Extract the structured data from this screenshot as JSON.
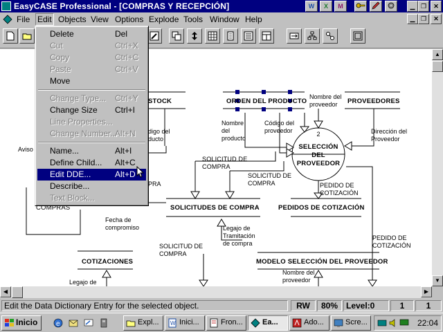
{
  "window": {
    "title": "EasyCASE Professional - [COMPRAS Y RECEPCIÓN]",
    "quick_buttons": [
      "W",
      "X",
      "M",
      "",
      "",
      "",
      ""
    ]
  },
  "menubar": {
    "items": [
      "File",
      "Edit",
      "Objects",
      "View",
      "Options",
      "Explode",
      "Tools",
      "Window",
      "Help"
    ]
  },
  "edit_menu": {
    "items": [
      {
        "label": "Delete",
        "accel": "Del",
        "enabled": true
      },
      {
        "label": "Cut",
        "accel": "Ctrl+X",
        "enabled": false
      },
      {
        "label": "Copy",
        "accel": "Ctrl+C",
        "enabled": false
      },
      {
        "label": "Paste",
        "accel": "Ctrl+V",
        "enabled": false
      },
      {
        "label": "Move",
        "accel": "",
        "enabled": true
      },
      {
        "label": "Change Type...",
        "accel": "Ctrl+Y",
        "enabled": false
      },
      {
        "label": "Change Size",
        "accel": "Ctrl+I",
        "enabled": true
      },
      {
        "label": "Line Properties...",
        "accel": "",
        "enabled": false
      },
      {
        "label": "Change Number...",
        "accel": "Alt+N",
        "enabled": false
      },
      {
        "label": "Name...",
        "accel": "Alt+I",
        "enabled": true
      },
      {
        "label": "Define Child...",
        "accel": "Alt+C",
        "enabled": true
      },
      {
        "label": "Edit DDE...",
        "accel": "Alt+D",
        "enabled": true,
        "selected": true
      },
      {
        "label": "Describe...",
        "accel": "",
        "enabled": true
      },
      {
        "label": "Text Block...",
        "accel": "",
        "enabled": false
      }
    ]
  },
  "diagram": {
    "stores": [
      "STOCK",
      "ORDEN DEL PRODUCTO",
      "PROVEEDORES",
      "SOLICITUDES DE COMPRA",
      "PEDIDOS DE COTIZACIÓN",
      "COTIZACIONES",
      "MODELO SELECCIÓN DEL PROVEEDOR"
    ],
    "process": {
      "number": "2",
      "name": "SELECCIÓN DEL PROVEEDOR"
    },
    "flows": [
      "Nombre del producto",
      "Código del proveedor",
      "Nombre del proveedor",
      "Dirección del Proveedor",
      "SOLICITUD DE COMPRA",
      "SOLICITUD DE COMPRA",
      "PEDIDO DE COTIZACIÓN",
      "PEDIDO DE COTIZACIÓN",
      "Legajo de Tramitación de compra",
      "Fecha de compromiso",
      "SOLICITUD DE COMPRA",
      "Legajo de",
      "Nombre del proveedor",
      "digo del ducto",
      "Aviso",
      "COMPRAS",
      "PRA"
    ]
  },
  "statusbar": {
    "message": "Edit the Data Dictionary Entry for the selected object.",
    "mode": "RW",
    "zoom": "80%",
    "level": "Level:0",
    "page": "1",
    "count": "1"
  },
  "taskbar": {
    "start_label": "Inicio",
    "tasks": [
      "Expl...",
      "Inici...",
      "Fron...",
      "Ea...",
      "Ado...",
      "Scre..."
    ],
    "clock": "22:04"
  }
}
